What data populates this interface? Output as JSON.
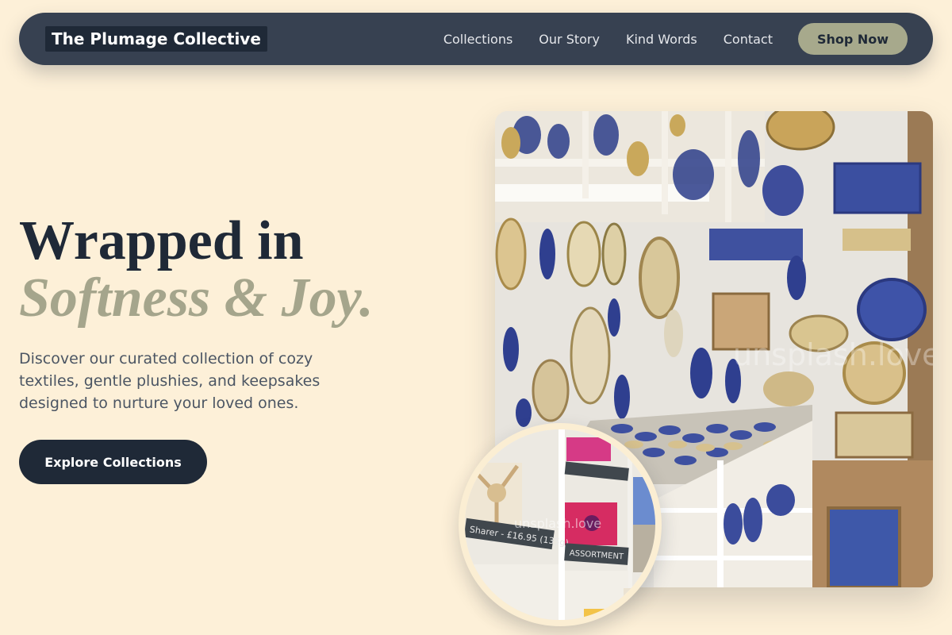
{
  "nav": {
    "logo": "The Plumage Collective",
    "links": [
      "Collections",
      "Our Story",
      "Kind Words",
      "Contact"
    ],
    "cta": "Shop Now"
  },
  "hero": {
    "headline_line1": "Wrapped in",
    "headline_line2": "Softness & Joy.",
    "subtext": "Discover our curated collection of cozy textiles, gentle plushies, and keepsakes designed to nurture your loved ones.",
    "cta": "Explore Collections"
  },
  "images": {
    "main": "pottery-shop-photo",
    "inset": "gift-boxes-shelf-photo",
    "main_watermark": "unsplash.love",
    "inset_watermark": "unsplash.love",
    "inset_label_1": "Sharer - £16.95 (135g)",
    "inset_label_2": "ASSORTMENT"
  },
  "colors": {
    "background": "#fdf0d8",
    "nav": "#374151",
    "dark": "#1f2937",
    "accent": "#a7a98c"
  }
}
